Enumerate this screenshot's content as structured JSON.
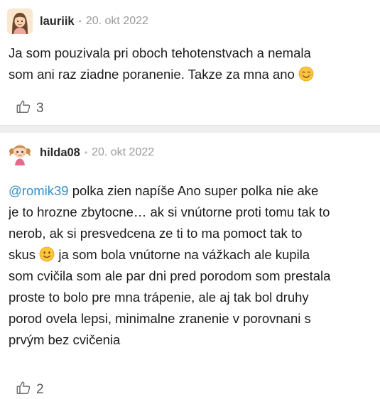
{
  "comments": [
    {
      "username": "lauriik",
      "separator": "•",
      "date": "20. okt 2022",
      "text": "Ja som pouzivala pri oboch tehotenstvach a nemala\nsom ani raz ziadne poranenie. Takze za mna ano",
      "text_emoji": "smiling-blush-emoji",
      "avatar_icon": "avatar-girl-icon",
      "likes": "3"
    },
    {
      "username": "hilda08",
      "separator": "•",
      "date": "20. okt 2022",
      "mention": "@romik39",
      "text_line1": " polka zien napíše Ano super polka nie ake",
      "text_part1": "je to hrozne zbytocne… ak si vnútorne proti tomu tak to\nnerob, ak si presvedcena ze ti to ma pomoct tak to\nskus ",
      "text_part2": " ja som bola vnútorne na vážkach ale kupila\nsom cvičila som ale par dni pred porodom som prestala\nproste to bolo pre mna trápenie, ale aj tak bol druhy\nporod ovela lepsi, minimalne zranenie v porovnani s\nprvým bez cvičenia",
      "text_emoji": "slight-smile-emoji",
      "avatar_icon": "avatar-girl-pigtails-icon",
      "likes": "2"
    }
  ],
  "colors": {
    "mention": "#3a8ec7",
    "divider": "#efefef",
    "meta_gray": "#9a9a9a"
  }
}
